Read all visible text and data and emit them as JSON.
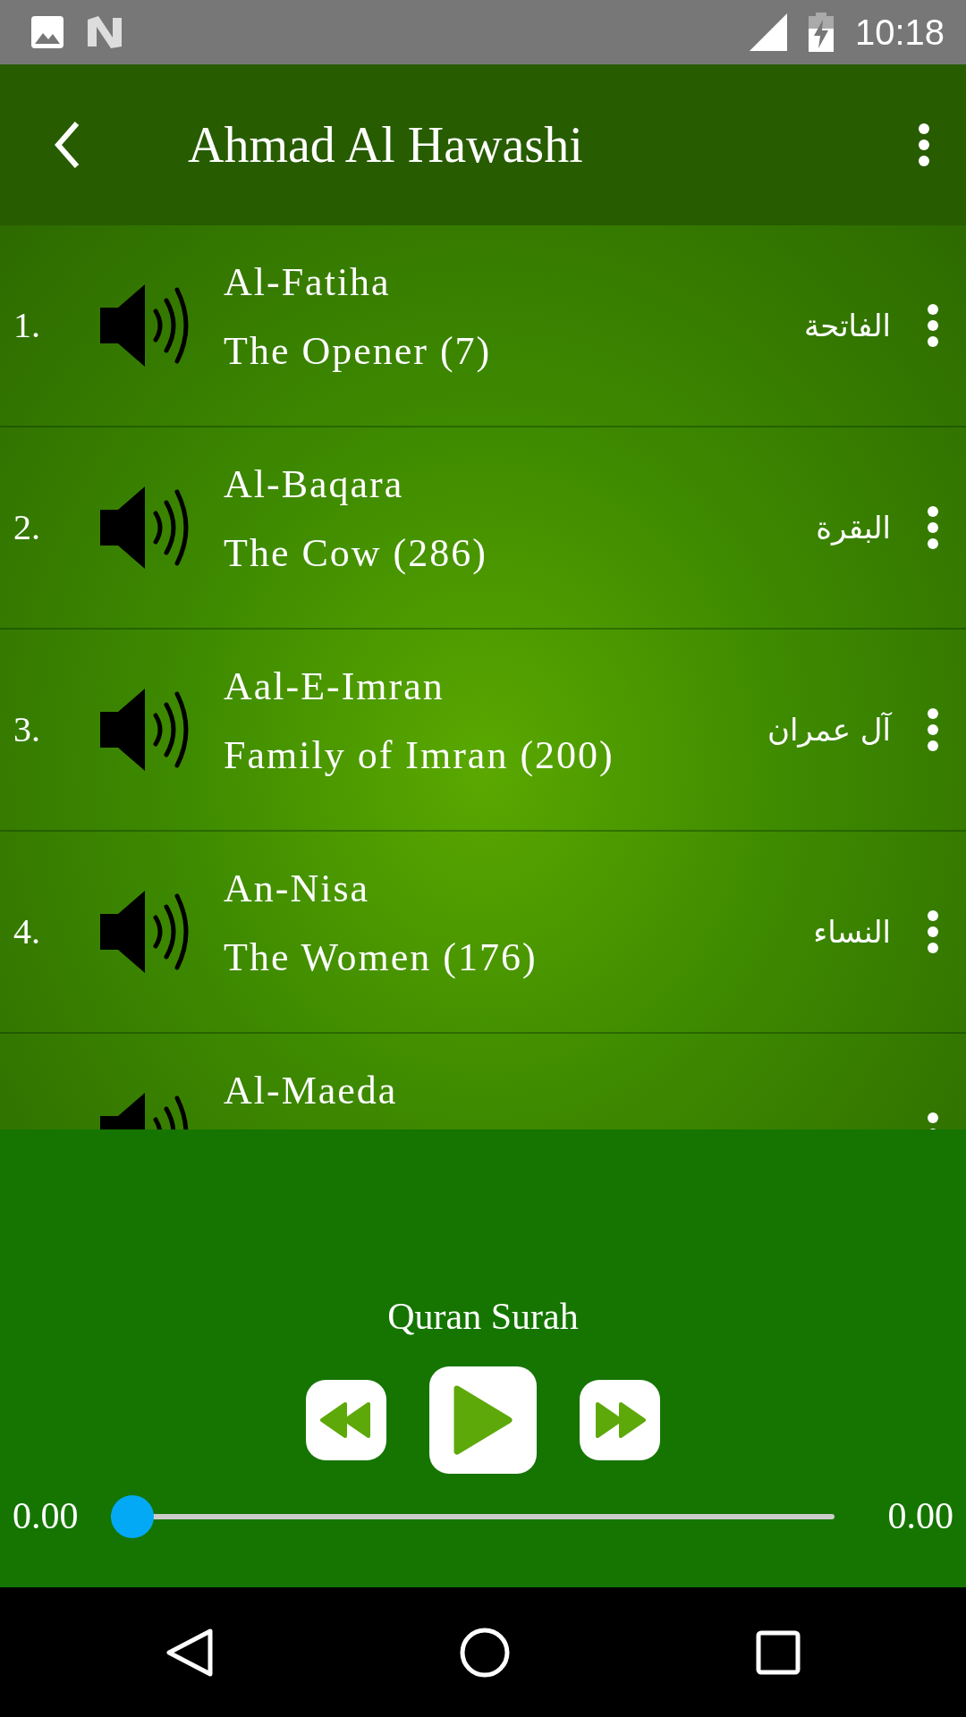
{
  "status_bar": {
    "time": "10:18"
  },
  "toolbar": {
    "title": "Ahmad Al Hawashi"
  },
  "surahs": [
    {
      "number": "1.",
      "title": "Al-Fatiha",
      "subtitle": "The Opener (7)",
      "arabic": "الفاتحة"
    },
    {
      "number": "2.",
      "title": "Al-Baqara",
      "subtitle": "The Cow (286)",
      "arabic": "البقرة"
    },
    {
      "number": "3.",
      "title": "Aal-E-Imran",
      "subtitle": "Family of Imran (200)",
      "arabic": "آل عمران"
    },
    {
      "number": "4.",
      "title": "An-Nisa",
      "subtitle": "The Women (176)",
      "arabic": "النساء"
    },
    {
      "title": "Al-Maeda"
    }
  ],
  "player": {
    "title": "Quran Surah",
    "elapsed": "0.00",
    "total": "0.00",
    "level": 0
  }
}
